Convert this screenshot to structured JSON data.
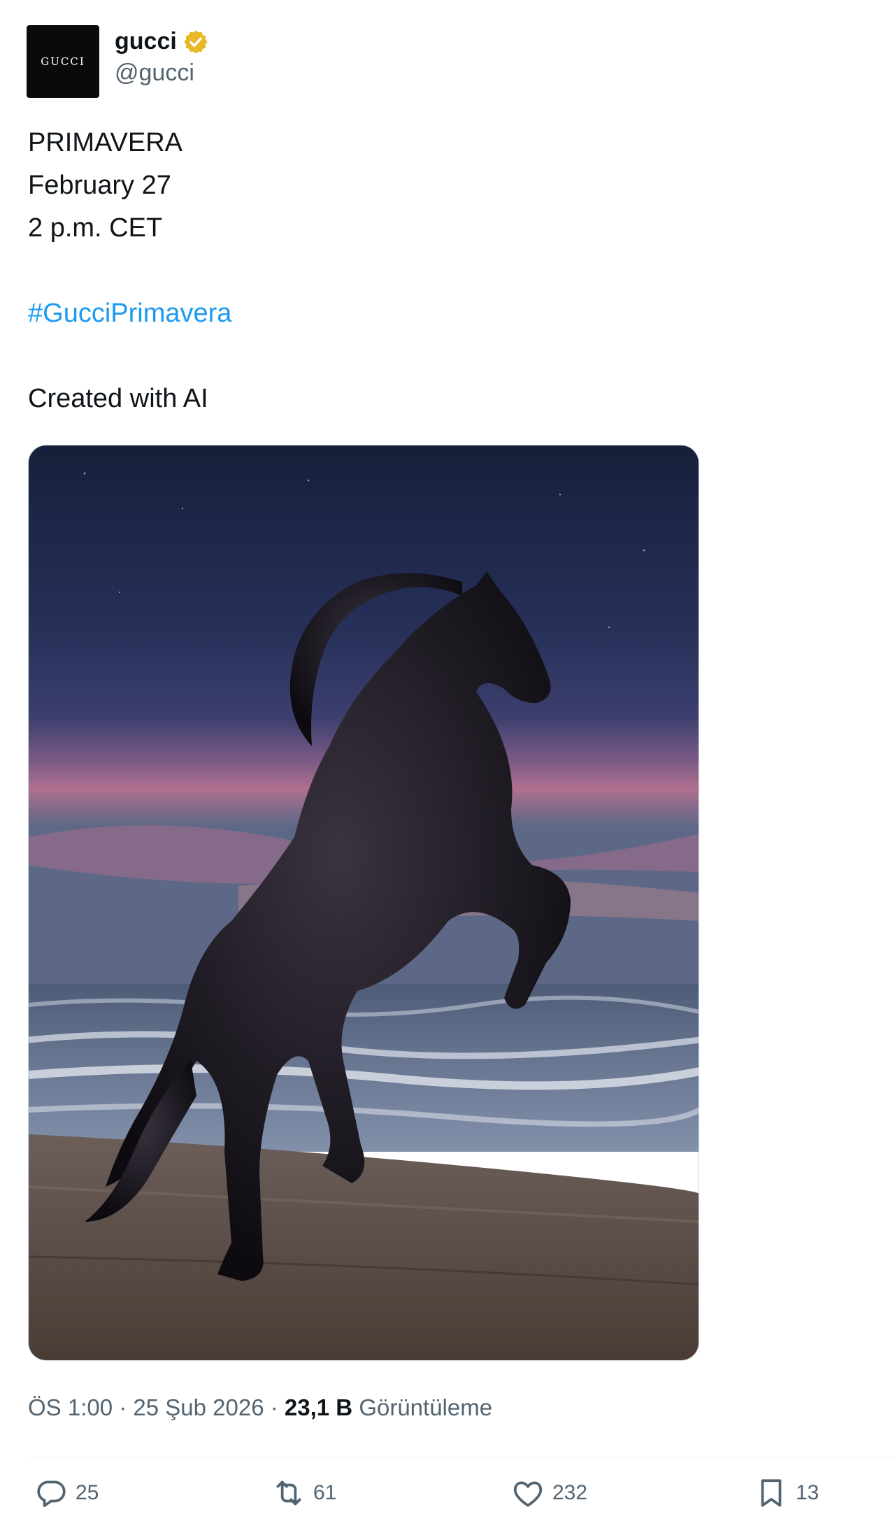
{
  "author": {
    "display_name": "gucci",
    "handle": "@gucci",
    "avatar_text": "GUCCI",
    "verified": true
  },
  "tweet": {
    "lines": [
      "PRIMAVERA",
      "February 27",
      "2 p.m. CET"
    ],
    "hashtag": "#GucciPrimavera",
    "note": "Created with AI"
  },
  "meta": {
    "time": "ÖS 1:00",
    "date": "25 Şub 2026",
    "separator": " · ",
    "views_count": "23,1 B",
    "views_label": "Görüntüleme"
  },
  "actions": {
    "replies": "25",
    "reposts": "61",
    "likes": "232",
    "bookmarks": "13"
  },
  "colors": {
    "text": "#0f1419",
    "secondary": "#536471",
    "link": "#1d9bf0",
    "verified_badge": "#e8b829"
  }
}
